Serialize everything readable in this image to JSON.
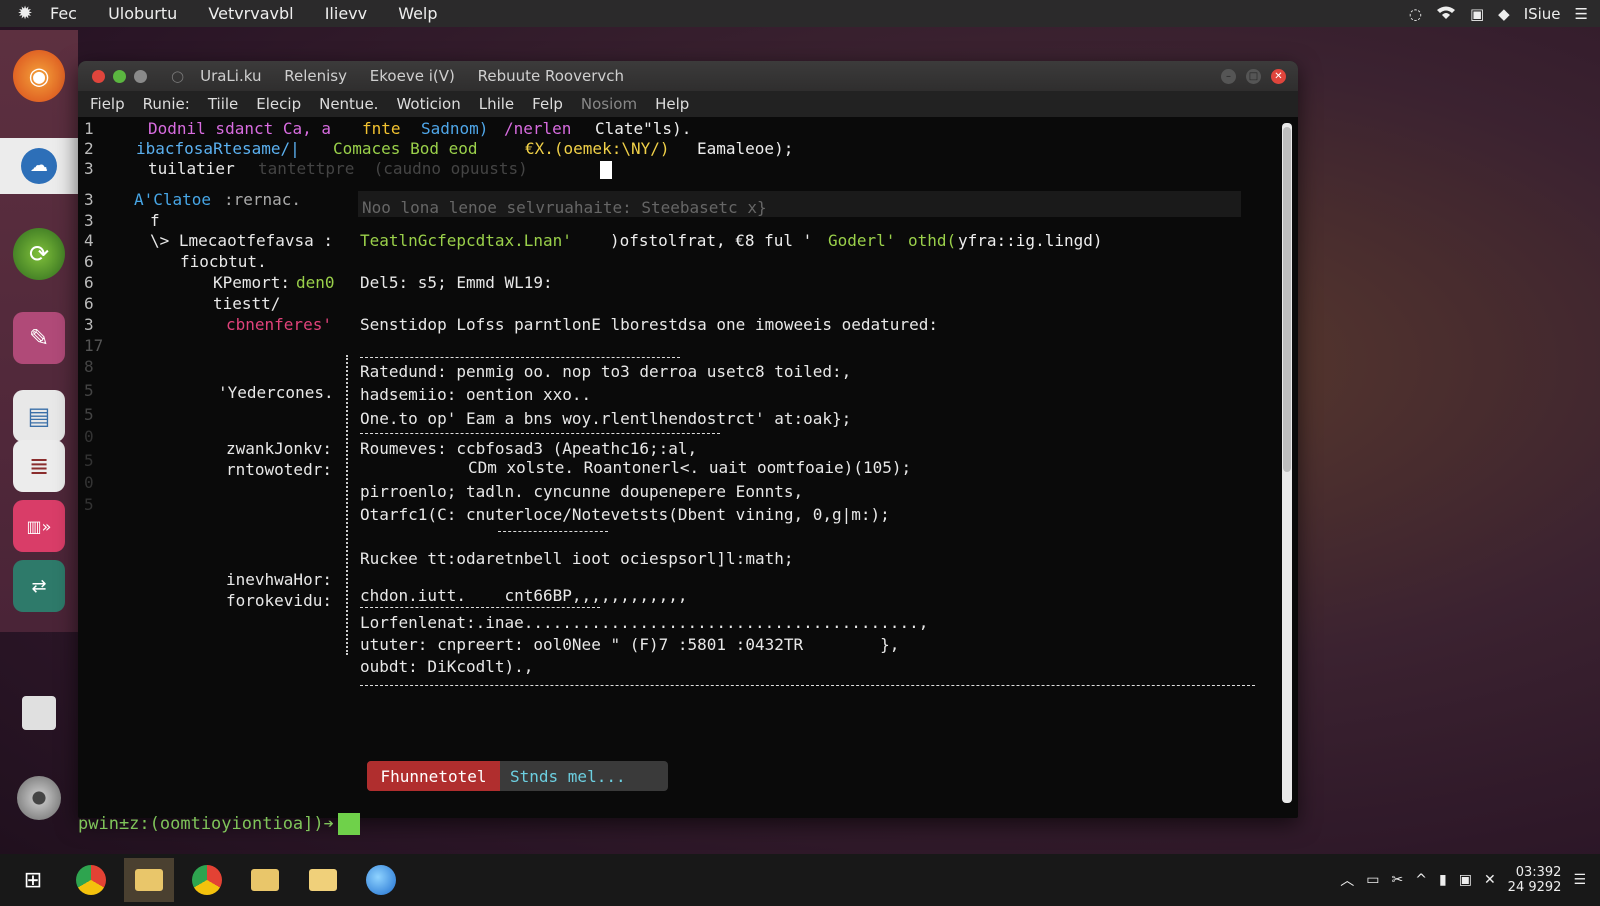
{
  "topbar": {
    "menu": [
      "Fec",
      "Uloburtu",
      "Vetvrvavbl",
      "Ilievv",
      "Welp"
    ],
    "tray_text": "ISiue"
  },
  "window": {
    "tabs": [
      "UraLi.ku",
      "Relenisy",
      "Ekoeve i(V)",
      "Rebuute Roovervch"
    ],
    "menu": [
      "Fielp",
      "Runie:",
      "Tiile",
      "Elecip",
      "Nentue.",
      "Woticion",
      "Lhile",
      "Felp",
      "Nosiom",
      "Help"
    ]
  },
  "terminal": {
    "line_numbers": [
      "1",
      "2",
      "3",
      "3",
      "3",
      "4",
      "6",
      "6",
      "6",
      "3",
      "17",
      "8",
      "5",
      "5",
      "0",
      "5",
      "0",
      "5"
    ],
    "lines": {
      "l1": "Dodnil sdanct Ca, a",
      "l1b": "fnte",
      "l1c": "Sadnom)",
      "l1d": "/nerlen",
      "l1e": "Clate\"ls).",
      "l2a": "ibacfosaRtesame/|",
      "l2b": "Comaces Bod eod",
      "l2c": "€X.(oemek:\\NY/)",
      "l2d": "Eamaleoe);",
      "l3": "tuilatier",
      "l3ghost": "tantettpre  (caudno opuusts)",
      "l4a": "A'Clatoe",
      "l4b": ":rernac.",
      "l4ghost": "Noo lona lenoe selvruahaite: Steebasetc x}",
      "l5a": "\\> Lmecaotfefavsa :",
      "l5b": "TeatlnGcfepcdtax.Lnan'",
      "l5c": ")ofstolfrat, €8 ful '",
      "l5d": "Goderl'",
      "l5e": "othd(",
      "l5f": "yfra::ig.lingd)",
      "l6": "fiocbtut.",
      "l7a": "KPemort:",
      "l7b": "den0",
      "l7c": "Del5: s5; Emmd WL19:",
      "l8": "tiestt/",
      "l9a": "cbnenferes'",
      "l9b": "Senstidop Lofss parntlonE lborestdsa one imoweeis oedatured:",
      "l10a": "'Yedercones.",
      "l10b": "Ratedund: penmig oo. nop to3 derroa usetc8 toiled:,",
      "l11": "hadsemiio: oention xxo..",
      "l12": "One.to op' Eam a bns woy.rlentlhendostrct' at:oak};",
      "l13a": "zwankJonkv:",
      "l13b": "Roumeves: ccbfosad3 (Apeathc16;:al,",
      "l14a": "rntowotedr:",
      "l14b": "CDm xolste. Roantonerl<. uait oomtfoaie)(105);",
      "l15": "pirroenlo; tadln. cyncunne doupenepere Eonnts,",
      "l16": "Otarfc1(C: cnuterloce/Notevetsts(Dbent vining, 0,g|m:);",
      "l17": "Ruckee tt:odaretnbell ioot ociespsorl]l:math;",
      "l18a": "inevhwaHor:",
      "l18b": "chdon.iutt.    cnt66BP,,,,,,,,,,,,",
      "l19a": "forokevidu:",
      "l19b": "Lorfenlenat:.inae.........................................,",
      "l20": "ututer: cnpreert: ool0Nee \" (F)7 :5801 :0432TR        },",
      "l21": "oubdt: DiKcodlt).,"
    },
    "status_red": "Fhunnetotel",
    "status_rest": "Stnds  mel..."
  },
  "prompt": "pwin±z:(oomtioyiontioa])➔",
  "taskbar": {
    "clock_time": "03:392",
    "clock_date": "24 9292"
  }
}
